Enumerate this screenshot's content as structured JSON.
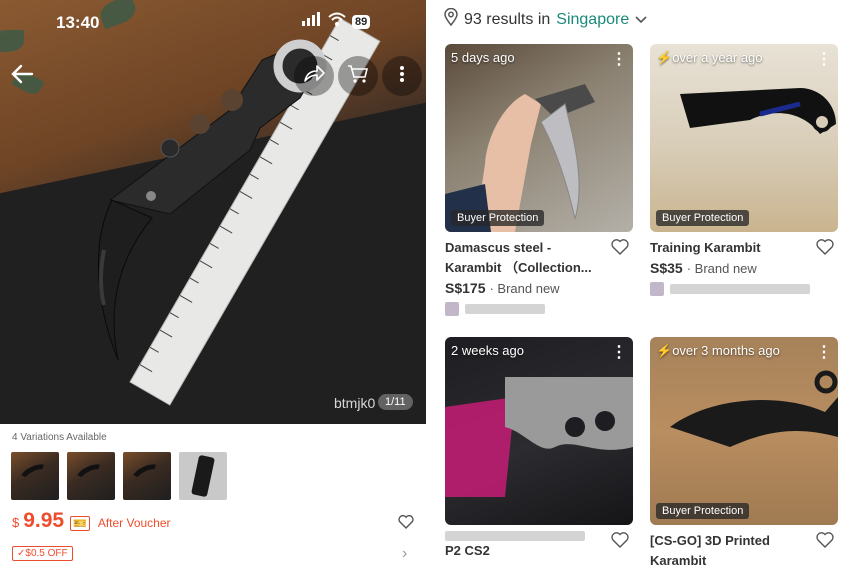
{
  "status": {
    "time": "13:40",
    "battery": "89"
  },
  "product": {
    "image_watermark": "btmjk0",
    "image_counter": "1/11",
    "variations_label": "4 Variations Available",
    "price_currency": "$",
    "price_amount": "9.95",
    "price_suffix": "After Voucher",
    "off_badge": "✓$0.5 OFF"
  },
  "search": {
    "results_prefix": "93 results in",
    "location": "Singapore"
  },
  "listings": [
    {
      "time": "5 days ago",
      "lightning": false,
      "buyer_protection": "Buyer Protection",
      "title": "Damascus steel - Karambit （Collection...",
      "price": "S$175",
      "condition": "· Brand new"
    },
    {
      "time": "over a year ago",
      "lightning": true,
      "buyer_protection": "Buyer Protection",
      "title": "Training Karambit",
      "price": "S$35",
      "condition": "· Brand new"
    },
    {
      "time": "2 weeks ago",
      "lightning": false,
      "buyer_protection": "",
      "title": "P2 CS2",
      "price": "",
      "condition": ""
    },
    {
      "time": "over 3 months ago",
      "lightning": true,
      "buyer_protection": "Buyer Protection",
      "title": "[CS-GO] 3D Printed Karambit",
      "price": "",
      "condition": ""
    }
  ],
  "icons": {
    "back": "arrow-left-icon",
    "share": "share-icon",
    "cart": "cart-icon",
    "more": "more-icon",
    "location": "location-pin-icon",
    "heart": "heart-outline-icon"
  },
  "colors": {
    "accent": "#ee4d2d",
    "location": "#1a8a7a"
  }
}
